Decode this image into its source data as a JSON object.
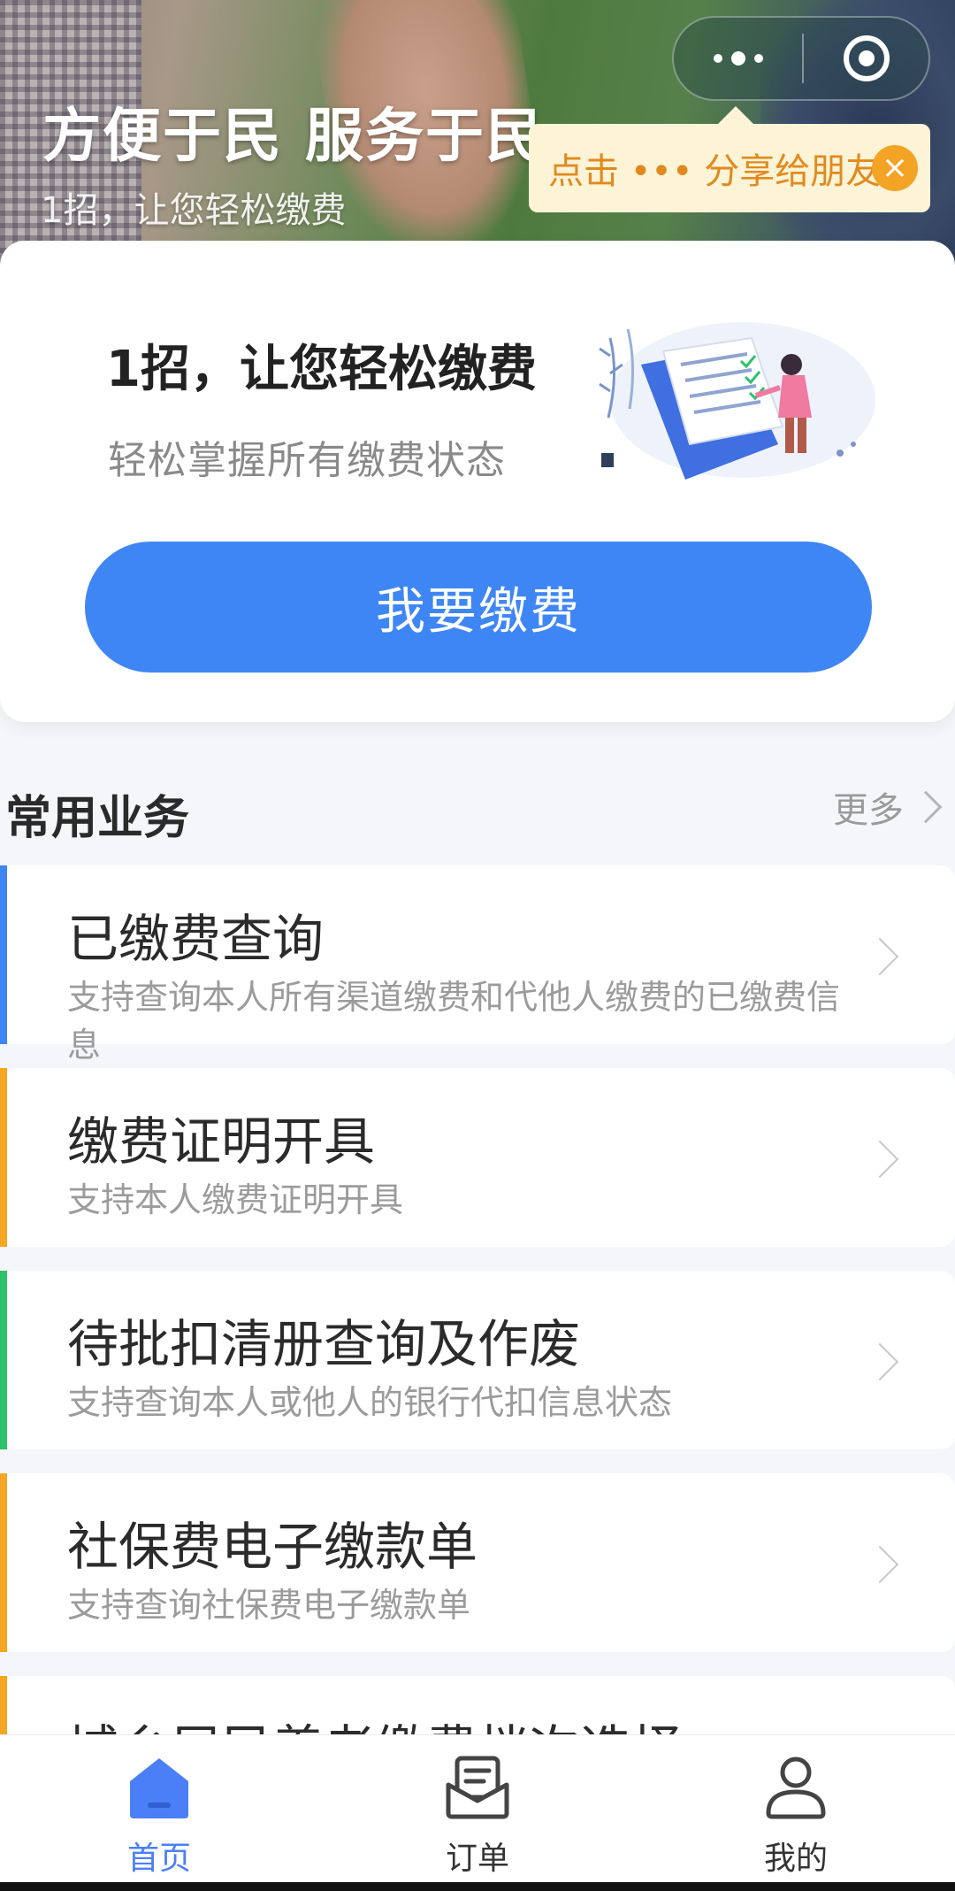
{
  "banner": {
    "title": "方便于民 服务于民",
    "subtitle": "1招，让您轻松缴费"
  },
  "capsule": {
    "more_icon": "more-dots-icon",
    "close_icon": "target-circle-icon"
  },
  "share_tip": {
    "text": "点击 ••• 分享给朋友",
    "close_icon": "close-icon"
  },
  "card": {
    "title": "1招，让您轻松缴费",
    "subtitle": "轻松掌握所有缴费状态",
    "button_label": "我要缴费"
  },
  "section": {
    "title": "常用业务",
    "more_label": "更多"
  },
  "items": [
    {
      "title": "已缴费查询",
      "desc": "支持查询本人所有渠道缴费和代他人缴费的已缴费信息",
      "accent": "#3f86f5"
    },
    {
      "title": "缴费证明开具",
      "desc": "支持本人缴费证明开具",
      "accent": "#f5a623"
    },
    {
      "title": "待批扣清册查询及作废",
      "desc": "支持查询本人或他人的银行代扣信息状态",
      "accent": "#2dc26b"
    },
    {
      "title": "社保费电子缴款单",
      "desc": "支持查询社保费电子缴款单",
      "accent": "#f5a623"
    },
    {
      "title": "城乡居民养老缴费档次选择",
      "desc": "",
      "accent": "#f5a623"
    }
  ],
  "tabs": [
    {
      "label": "首页",
      "icon": "home-icon",
      "active": true
    },
    {
      "label": "订单",
      "icon": "order-icon",
      "active": false
    },
    {
      "label": "我的",
      "icon": "user-icon",
      "active": false
    }
  ],
  "colors": {
    "primary": "#3f86f5",
    "tab_active": "#4a7ff7",
    "tip_text": "#e08a1e",
    "tip_bg": "#fdf3d6"
  }
}
